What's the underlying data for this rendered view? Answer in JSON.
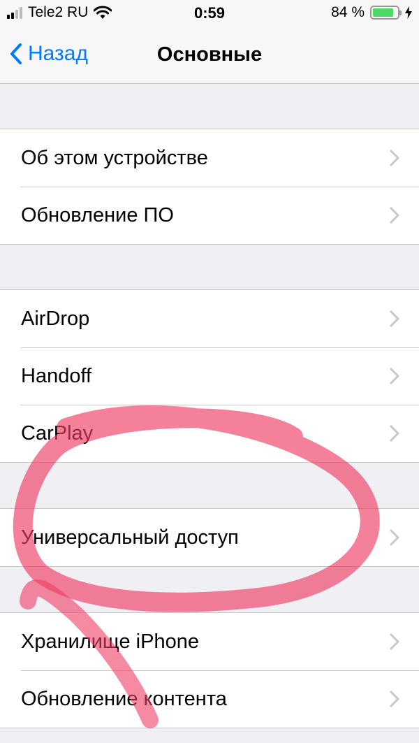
{
  "status_bar": {
    "carrier": "Tele2 RU",
    "time": "0:59",
    "battery_percent": "84 %",
    "battery_level": 0.84,
    "battery_color": "#4cd964"
  },
  "nav": {
    "back_label": "Назад",
    "title": "Основные",
    "accent_color": "#007aff"
  },
  "groups": [
    {
      "items": [
        {
          "label": "Об этом устройстве"
        },
        {
          "label": "Обновление ПО"
        }
      ]
    },
    {
      "items": [
        {
          "label": "AirDrop"
        },
        {
          "label": "Handoff"
        },
        {
          "label": "CarPlay"
        }
      ]
    },
    {
      "items": [
        {
          "label": "Универсальный доступ"
        }
      ]
    },
    {
      "items": [
        {
          "label": "Хранилище iPhone"
        },
        {
          "label": "Обновление контента"
        }
      ]
    }
  ],
  "annotation": {
    "color": "#f03c64",
    "target": "Универсальный доступ"
  }
}
